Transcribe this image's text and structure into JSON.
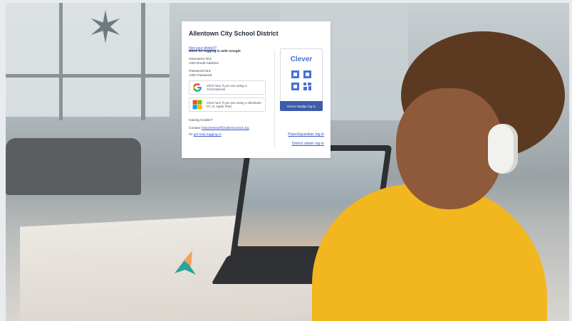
{
  "district": {
    "title": "Allentown City School District",
    "not_your_district": "Not your district?"
  },
  "hints": {
    "heading": "Hints for logging in with Google",
    "username_label": "Username hint:",
    "username_value": "ASD Email Address",
    "password_label": "Password hint:",
    "password_value": "ASD Password"
  },
  "login_buttons": {
    "google_label": "Click here if you are using a Chromebook",
    "windows_label": "Click here if you are using a Windows PC or Apple iPad"
  },
  "help": {
    "trouble": "Having trouble?",
    "contact_prefix": "Contact",
    "contact_email": "helpdeskstaff@allentownsd.org",
    "or_prefix": "Or",
    "help_link": "get help logging in"
  },
  "clever": {
    "logo": "Clever",
    "badge_button": "Clever Badge log in",
    "parent_link": "Parent/guardian log in",
    "admin_link": "District admin log in"
  },
  "colors": {
    "link": "#3b55c7",
    "clever_blue": "#4a6fd8",
    "badge_button": "#3d5ba9",
    "google_red": "#ea4335",
    "google_blue": "#4285f4",
    "google_yellow": "#fbbc05",
    "google_green": "#34a853",
    "ms_red": "#f25022",
    "ms_green": "#7fba00",
    "ms_blue": "#00a4ef",
    "ms_yellow": "#ffb900"
  },
  "icons": {
    "google": "google-icon",
    "windows": "windows-icon",
    "qr": "qr-code-icon"
  }
}
